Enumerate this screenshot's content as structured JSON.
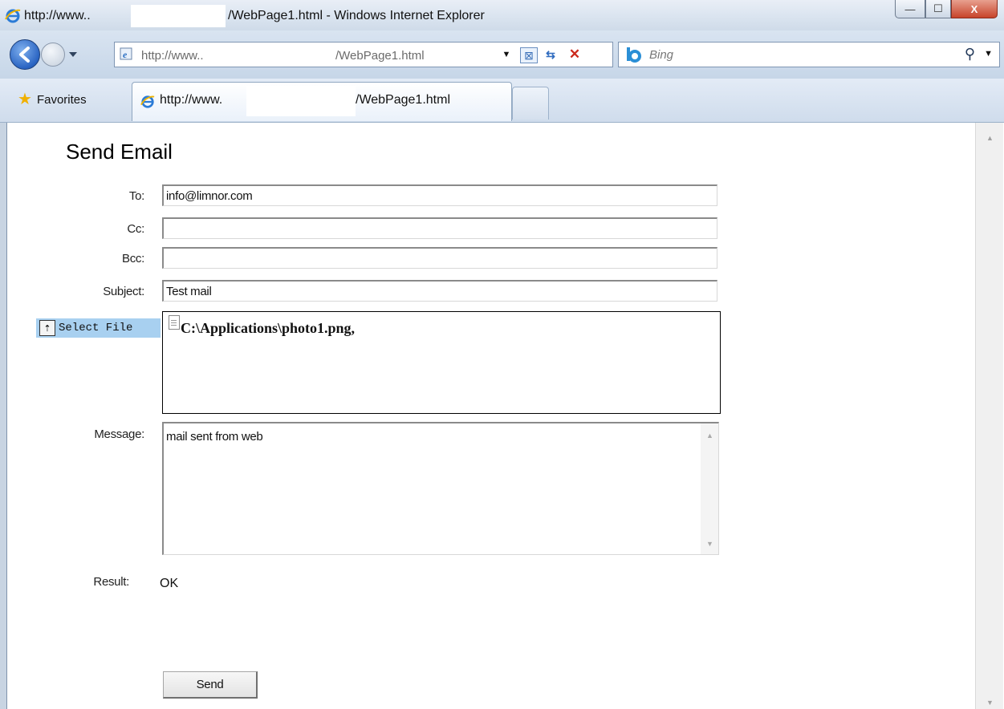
{
  "window": {
    "title_prefix": "http://www..",
    "title_suffix": "/WebPage1.html - Windows Internet Explorer",
    "controls": {
      "minimize": "—",
      "maximize": "☐",
      "close": "X"
    }
  },
  "navbar": {
    "address_prefix": "http://www..",
    "address_suffix": "/WebPage1.html",
    "search_placeholder": "Bing",
    "search_icon": "⚲"
  },
  "favbar": {
    "favorites_label": "Favorites",
    "tab_prefix": "http://www.",
    "tab_suffix": "/WebPage1.html"
  },
  "form": {
    "heading": "Send Email",
    "to_label": "To:",
    "to_value": "info@limnor.com",
    "cc_label": "Cc:",
    "cc_value": "",
    "bcc_label": "Bcc:",
    "bcc_value": "",
    "subject_label": "Subject:",
    "subject_value": "Test mail",
    "select_file_label": "Select File",
    "attached_file": "C:\\Applications\\photo1.png,",
    "message_label": "Message:",
    "message_value": "mail sent from web",
    "result_label": "Result:",
    "result_value": "OK",
    "send_label": "Send"
  },
  "colors": {
    "select_file_bg": "#a8d0f0",
    "chrome_blue": "#cfdbe9",
    "close_red": "#c7432a"
  }
}
